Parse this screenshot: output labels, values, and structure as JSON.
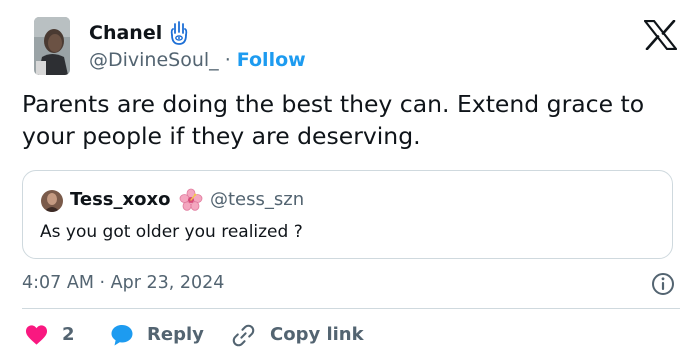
{
  "author": {
    "name": "Chanel",
    "handle": "@DivineSoul_",
    "separator": " · ",
    "follow_label": "Follow",
    "badge_icon": "hamsa-hand-icon"
  },
  "tweet": {
    "text": "Parents are doing the best they can. Extend grace to your people if they are deserving.",
    "timestamp": "4:07 AM · Apr 23, 2024"
  },
  "quoted_tweet": {
    "name": "Tess_xoxo",
    "emoji_icon": "hibiscus-icon",
    "handle": "@tess_szn",
    "text": "As you got older you realized ?"
  },
  "actions": {
    "like_count": "2",
    "reply_label": "Reply",
    "copy_link_label": "Copy link"
  },
  "colors": {
    "accent": "#1d9bf0",
    "like": "#f91880",
    "secondary_text": "#536471",
    "border": "#cfd9de"
  }
}
